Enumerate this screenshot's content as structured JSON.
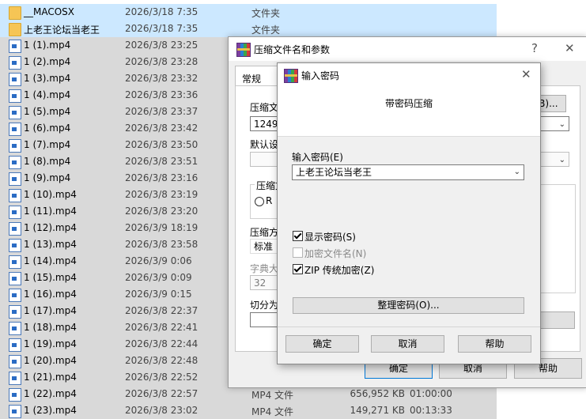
{
  "files": [
    {
      "name": "__MACOSX",
      "date": "2026/3/18 7:35",
      "type": "文件夹",
      "size": "",
      "duration": "",
      "kind": "folder"
    },
    {
      "name": "上老王论坛当老王",
      "date": "2026/3/18 7:35",
      "type": "文件夹",
      "size": "",
      "duration": "",
      "kind": "folder"
    },
    {
      "name": "1 (1).mp4",
      "date": "2026/3/8 23:25",
      "type": "",
      "size": "",
      "duration": "",
      "kind": "mp4"
    },
    {
      "name": "1 (2).mp4",
      "date": "2026/3/8 23:28",
      "type": "",
      "size": "",
      "duration": "",
      "kind": "mp4"
    },
    {
      "name": "1 (3).mp4",
      "date": "2026/3/8 23:32",
      "type": "",
      "size": "",
      "duration": "",
      "kind": "mp4"
    },
    {
      "name": "1 (4).mp4",
      "date": "2026/3/8 23:36",
      "type": "",
      "size": "",
      "duration": "",
      "kind": "mp4"
    },
    {
      "name": "1 (5).mp4",
      "date": "2026/3/8 23:37",
      "type": "",
      "size": "",
      "duration": "",
      "kind": "mp4"
    },
    {
      "name": "1 (6).mp4",
      "date": "2026/3/8 23:42",
      "type": "",
      "size": "",
      "duration": "",
      "kind": "mp4"
    },
    {
      "name": "1 (7).mp4",
      "date": "2026/3/8 23:50",
      "type": "",
      "size": "",
      "duration": "",
      "kind": "mp4"
    },
    {
      "name": "1 (8).mp4",
      "date": "2026/3/8 23:51",
      "type": "",
      "size": "",
      "duration": "",
      "kind": "mp4"
    },
    {
      "name": "1 (9).mp4",
      "date": "2026/3/8 23:16",
      "type": "",
      "size": "",
      "duration": "",
      "kind": "mp4"
    },
    {
      "name": "1 (10).mp4",
      "date": "2026/3/8 23:19",
      "type": "",
      "size": "",
      "duration": "",
      "kind": "mp4"
    },
    {
      "name": "1 (11).mp4",
      "date": "2026/3/8 23:20",
      "type": "",
      "size": "",
      "duration": "",
      "kind": "mp4"
    },
    {
      "name": "1 (12).mp4",
      "date": "2026/3/9 18:19",
      "type": "",
      "size": "",
      "duration": "",
      "kind": "mp4"
    },
    {
      "name": "1 (13).mp4",
      "date": "2026/3/8 23:58",
      "type": "",
      "size": "",
      "duration": "",
      "kind": "mp4"
    },
    {
      "name": "1 (14).mp4",
      "date": "2026/3/9 0:06",
      "type": "",
      "size": "",
      "duration": "",
      "kind": "mp4"
    },
    {
      "name": "1 (15).mp4",
      "date": "2026/3/9 0:09",
      "type": "",
      "size": "",
      "duration": "",
      "kind": "mp4"
    },
    {
      "name": "1 (16).mp4",
      "date": "2026/3/9 0:15",
      "type": "",
      "size": "",
      "duration": "",
      "kind": "mp4"
    },
    {
      "name": "1 (17).mp4",
      "date": "2026/3/8 22:37",
      "type": "",
      "size": "",
      "duration": "",
      "kind": "mp4"
    },
    {
      "name": "1 (18).mp4",
      "date": "2026/3/8 22:41",
      "type": "",
      "size": "",
      "duration": "",
      "kind": "mp4"
    },
    {
      "name": "1 (19).mp4",
      "date": "2026/3/8 22:44",
      "type": "",
      "size": "",
      "duration": "",
      "kind": "mp4"
    },
    {
      "name": "1 (20).mp4",
      "date": "2026/3/8 22:48",
      "type": "",
      "size": "",
      "duration": "",
      "kind": "mp4"
    },
    {
      "name": "1 (21).mp4",
      "date": "2026/3/8 22:52",
      "type": "",
      "size": "",
      "duration": "",
      "kind": "mp4"
    },
    {
      "name": "1 (22).mp4",
      "date": "2026/3/8 22:57",
      "type": "MP4 文件",
      "size": "656,952 KB",
      "duration": "01:00:00",
      "kind": "mp4"
    },
    {
      "name": "1 (23).mp4",
      "date": "2026/3/8 23:02",
      "type": "MP4 文件",
      "size": "149,271 KB",
      "duration": "00:13:33",
      "kind": "mp4"
    }
  ],
  "archive_dialog": {
    "title": "压缩文件名和参数",
    "help_glyph": "?",
    "close_glyph": "✕",
    "tab_general": "常规",
    "label_archive_name": "压缩文",
    "archive_name_value": "1249.z",
    "browse_label": "(B)...",
    "label_default": "默认设",
    "group_format": "压缩文",
    "format_radio_fragment": "R",
    "label_method": "压缩方",
    "method_value": "标准",
    "label_dict": "字典大",
    "dict_value": "32",
    "label_split": "切分为",
    "ok_label": "确定",
    "cancel_label": "取消",
    "help_label": "帮助"
  },
  "password_dialog": {
    "title": "输入密码",
    "close_glyph": "✕",
    "heading": "带密码压缩",
    "label_password": "输入密码(E)",
    "password_value": "上老王论坛当老王",
    "show_password_label": "显示密码(S)",
    "show_password_checked": true,
    "encrypt_names_label": "加密文件名(N)",
    "encrypt_names_checked": false,
    "zip_legacy_label": "ZIP 传统加密(Z)",
    "zip_legacy_checked": true,
    "organize_label": "整理密码(O)...",
    "ok_label": "确定",
    "cancel_label": "取消",
    "help_label": "帮助"
  }
}
